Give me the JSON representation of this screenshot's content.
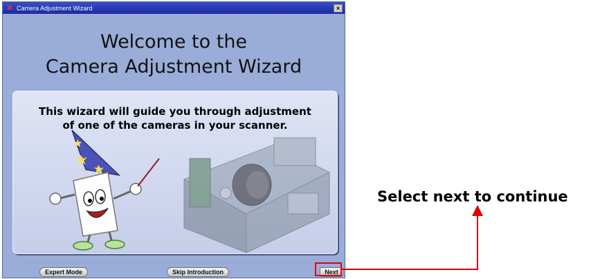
{
  "window": {
    "title": "Camera Adjustment Wizard",
    "close_label": "×"
  },
  "heading": {
    "line1": "Welcome to the",
    "line2": "Camera Adjustment Wizard"
  },
  "panel": {
    "line1": "This wizard will guide you through adjustment",
    "line2": "of one of the cameras in your scanner."
  },
  "buttons": {
    "expert_mode": "Expert Mode",
    "skip_intro": "Skip Introduction",
    "next": "Next"
  },
  "annotation": {
    "callout": "Select next to continue",
    "highlight_color": "#e00000"
  },
  "icons": {
    "app_logo": "x-logo-icon",
    "close": "close-icon",
    "wizard_mascot": "wizard-mascot",
    "scanner_camera": "scanner-camera-illustration"
  }
}
